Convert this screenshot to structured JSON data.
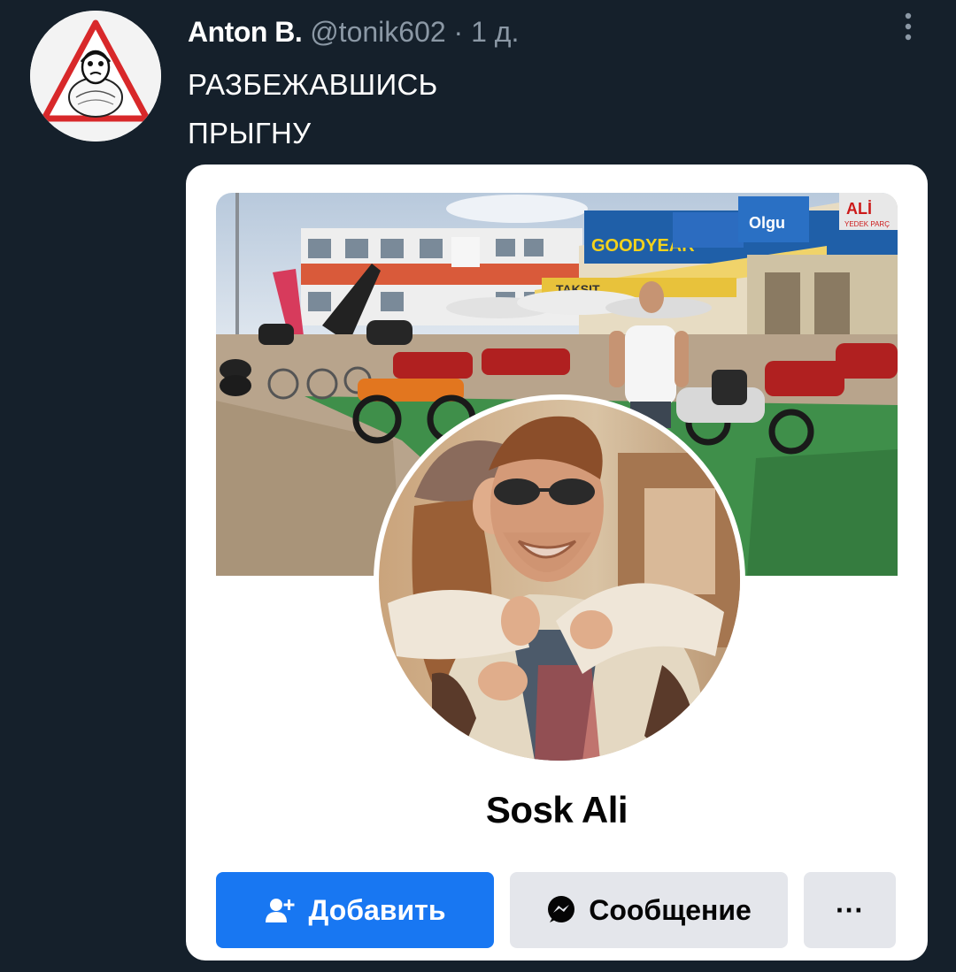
{
  "tweet": {
    "author_name": "Anton B.",
    "handle": "@tonik602",
    "separator": "·",
    "time": "1 д.",
    "lines": [
      "РАЗБЕЖАВШИСЬ",
      "ПРЫГНУ"
    ]
  },
  "embed": {
    "profile_name": "Sosk Ali",
    "buttons": {
      "add_label": "Добавить",
      "message_label": "Сообщение",
      "more_label": "···"
    },
    "cover_texts": {
      "goodyear": "GOODYEAR",
      "olgu": "Olgu",
      "taksit": "TAKSIT",
      "ali": "ALİ",
      "yedek": "YEDEK PARÇ"
    }
  },
  "colors": {
    "background": "#15202b",
    "secondary_text": "#8b98a5",
    "fb_blue": "#1877f2",
    "fb_gray_button": "#e4e6eb"
  }
}
